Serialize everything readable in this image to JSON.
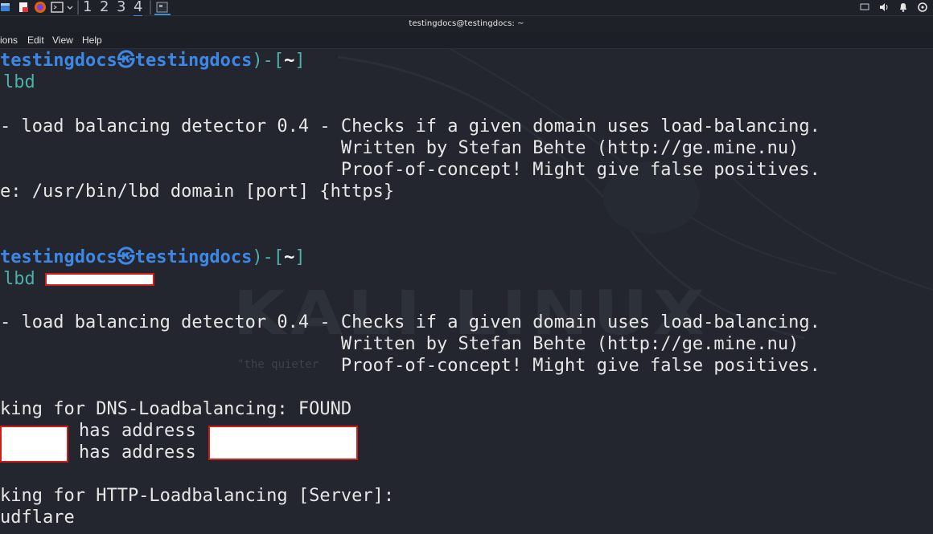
{
  "panel": {
    "workspaces": [
      "1",
      "2",
      "3",
      "4"
    ],
    "active_workspace": "4"
  },
  "window": {
    "title": "testingdocs@testingdocs: ~"
  },
  "menu": {
    "actions": "ions",
    "edit": "Edit",
    "view": "View",
    "help": "Help"
  },
  "terminal": {
    "prompt1": {
      "user": "testingdocs",
      "at": "㉿",
      "host": "testingdocs",
      "open": ")-[",
      "path": "~",
      "close": "]",
      "command": "lbd"
    },
    "out1": [
      "- load balancing detector 0.4 - Checks if a given domain uses load-balancing.",
      "                                Written by Stefan Behte (http://ge.mine.nu)",
      "                                Proof-of-concept! Might give false positives.",
      "e: /usr/bin/lbd domain [port] {https}"
    ],
    "prompt2": {
      "user": "testingdocs",
      "at": "㉿",
      "host": "testingdocs",
      "open": ")-[",
      "path": "~",
      "close": "]",
      "command": "lbd"
    },
    "out2": [
      "- load balancing detector 0.4 - Checks if a given domain uses load-balancing.",
      "                                Written by Stefan Behte (http://ge.mine.nu)",
      "                                Proof-of-concept! Might give false positives."
    ],
    "dns_check": "king for DNS-Loadbalancing: FOUND",
    "addr1": "has address",
    "addr2": "has address",
    "http_check": "king for HTTP-Loadbalancing [Server]:",
    "server": "udflare"
  },
  "wallpaper": {
    "logo_text": "KALI LINUX",
    "tagline": "\"the quieter"
  },
  "colors": {
    "prompt_blue": "#3d88e6",
    "prompt_teal": "#4ab0a8",
    "redaction_border": "#d11c1c"
  }
}
